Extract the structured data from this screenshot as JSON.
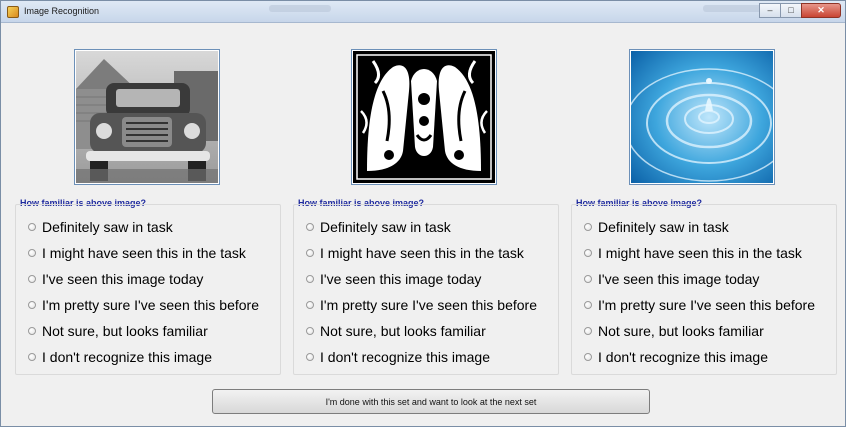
{
  "window": {
    "title": "Image Recognition"
  },
  "images": [
    {
      "icon": "vintage-truck-photo"
    },
    {
      "icon": "ornate-letter-m-woodcut"
    },
    {
      "icon": "water-ripple-photo"
    }
  ],
  "panels": [
    {
      "question": "How familiar is above image?",
      "options": [
        "Definitely saw in task",
        "I might have seen this in the task",
        "I've seen this image today",
        "I'm pretty sure I've seen this before",
        "Not sure, but looks familiar",
        "I don't recognize this image"
      ]
    },
    {
      "question": "How familiar is above image?",
      "options": [
        "Definitely saw in task",
        "I might have seen this in the task",
        "I've seen this image today",
        "I'm pretty sure I've seen this before",
        "Not sure, but looks familiar",
        "I don't recognize this image"
      ]
    },
    {
      "question": "How familiar is above image?",
      "options": [
        "Definitely saw in task",
        "I might have seen this in the task",
        "I've seen this image today",
        "I'm pretty sure I've seen this before",
        "Not sure, but looks familiar",
        "I don't recognize this image"
      ]
    }
  ],
  "next_button": {
    "label": "I'm done with this set and want to look at the next set"
  },
  "colors": {
    "question_text": "#1e2a9e",
    "image_border": "#6c90b8",
    "close_button": "#c94533"
  }
}
